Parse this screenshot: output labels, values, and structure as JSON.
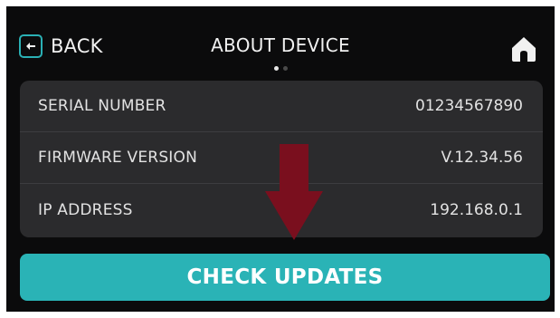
{
  "header": {
    "back_label": "BACK",
    "title": "ABOUT DEVICE",
    "page_indicator": {
      "current": 1,
      "total": 2
    }
  },
  "device_info": [
    {
      "label": "SERIAL NUMBER",
      "value": "01234567890"
    },
    {
      "label": "FIRMWARE VERSION",
      "value": "V.12.34.56"
    },
    {
      "label": "IP ADDRESS",
      "value": "192.168.0.1"
    }
  ],
  "actions": {
    "check_updates_label": "CHECK UPDATES"
  },
  "icons": {
    "back": "arrow-left-icon",
    "home": "home-icon",
    "annotation": "down-arrow-icon"
  },
  "colors": {
    "accent": "#2ab3b6",
    "background": "#0b0b0c",
    "card": "#2b2b2d",
    "annotation_arrow": "#7a0f1e"
  }
}
